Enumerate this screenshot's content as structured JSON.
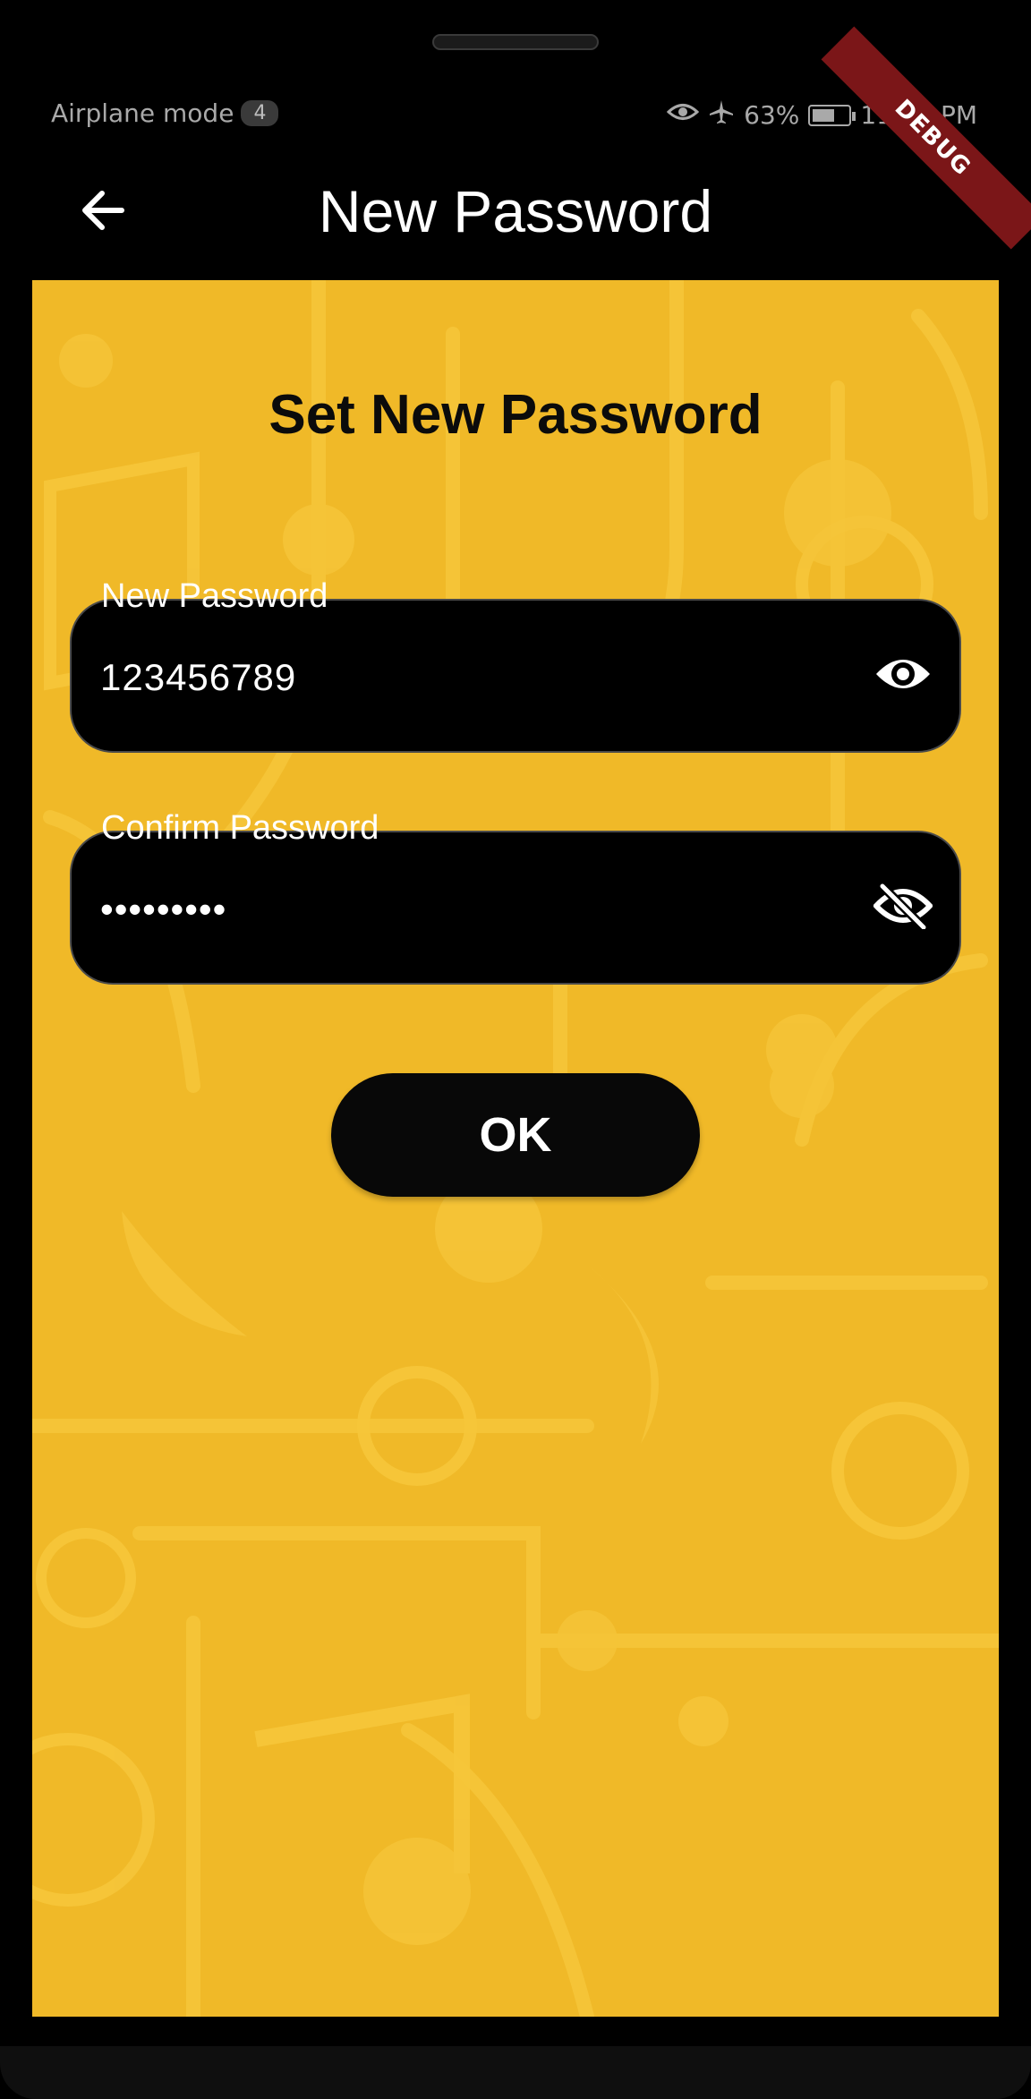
{
  "status_bar": {
    "left_text": "Airplane mode",
    "badge": "4",
    "battery_percent": "63%",
    "battery_level": 0.63,
    "time": "11:02 PM",
    "icons": [
      "eye-icon",
      "airplane-icon",
      "battery-charging-icon"
    ]
  },
  "debug_banner": "DEBUG",
  "app_bar": {
    "title": "New Password",
    "back_icon": "arrow-left-icon"
  },
  "form": {
    "heading": "Set New Password",
    "new_password": {
      "label": "New Password",
      "value": "123456789",
      "visibility_icon": "eye-icon"
    },
    "confirm_password": {
      "label": "Confirm Password",
      "value": "•••••••••",
      "visibility_icon": "eye-off-icon"
    },
    "ok_label": "OK"
  },
  "colors": {
    "background_yellow": "#f0b928",
    "field_fill": "#000000",
    "debug_ribbon": "#7b1618"
  }
}
